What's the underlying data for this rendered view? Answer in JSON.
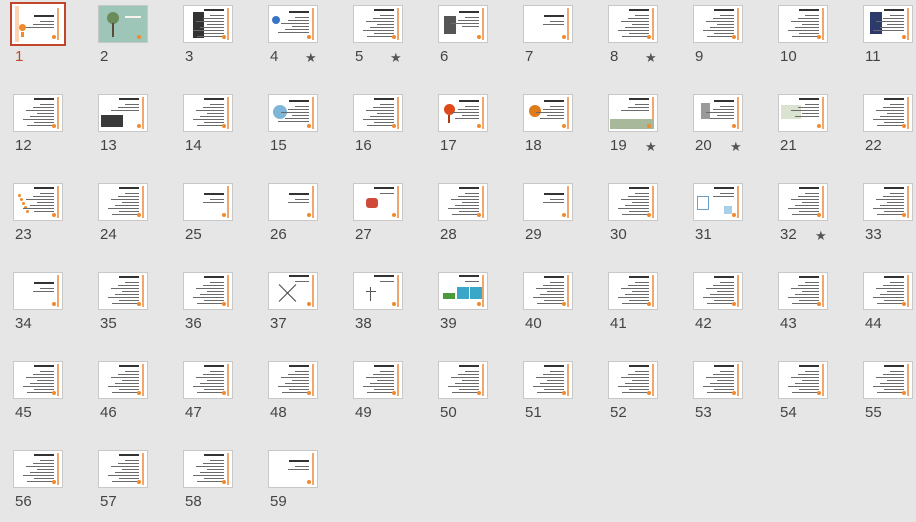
{
  "view": "Slide Sorter",
  "selected_slide": 1,
  "slides": [
    {
      "n": "1",
      "star": false,
      "pic": "title"
    },
    {
      "n": "2",
      "star": false,
      "pic": "tree"
    },
    {
      "n": "3",
      "star": false,
      "pic": "portrait"
    },
    {
      "n": "4",
      "star": true,
      "pic": "globe"
    },
    {
      "n": "5",
      "star": true,
      "pic": "text"
    },
    {
      "n": "6",
      "star": false,
      "pic": "portrait2"
    },
    {
      "n": "7",
      "star": false,
      "pic": "sparse"
    },
    {
      "n": "8",
      "star": true,
      "pic": "text"
    },
    {
      "n": "9",
      "star": false,
      "pic": "text"
    },
    {
      "n": "10",
      "star": false,
      "pic": "text"
    },
    {
      "n": "11",
      "star": false,
      "pic": "people"
    },
    {
      "n": "12",
      "star": false,
      "pic": "text"
    },
    {
      "n": "13",
      "star": false,
      "pic": "dark"
    },
    {
      "n": "14",
      "star": false,
      "pic": "text"
    },
    {
      "n": "15",
      "star": false,
      "pic": "bluefig"
    },
    {
      "n": "16",
      "star": false,
      "pic": "text"
    },
    {
      "n": "17",
      "star": false,
      "pic": "redsign"
    },
    {
      "n": "18",
      "star": false,
      "pic": "face"
    },
    {
      "n": "19",
      "star": true,
      "pic": "crowd"
    },
    {
      "n": "20",
      "star": true,
      "pic": "robot"
    },
    {
      "n": "21",
      "star": false,
      "pic": "map"
    },
    {
      "n": "22",
      "star": false,
      "pic": "text"
    },
    {
      "n": "23",
      "star": false,
      "pic": "dots"
    },
    {
      "n": "24",
      "star": false,
      "pic": "text"
    },
    {
      "n": "25",
      "star": false,
      "pic": "sparse"
    },
    {
      "n": "26",
      "star": false,
      "pic": "sparse"
    },
    {
      "n": "27",
      "star": false,
      "pic": "redicon"
    },
    {
      "n": "28",
      "star": false,
      "pic": "text"
    },
    {
      "n": "29",
      "star": false,
      "pic": "sparse"
    },
    {
      "n": "30",
      "star": false,
      "pic": "text"
    },
    {
      "n": "31",
      "star": false,
      "pic": "diagram"
    },
    {
      "n": "32",
      "star": true,
      "pic": "text"
    },
    {
      "n": "33",
      "star": false,
      "pic": "text"
    },
    {
      "n": "34",
      "star": false,
      "pic": "sparse"
    },
    {
      "n": "35",
      "star": false,
      "pic": "text"
    },
    {
      "n": "36",
      "star": false,
      "pic": "text"
    },
    {
      "n": "37",
      "star": false,
      "pic": "cross"
    },
    {
      "n": "38",
      "star": false,
      "pic": "figure"
    },
    {
      "n": "39",
      "star": false,
      "pic": "boxes"
    },
    {
      "n": "40",
      "star": false,
      "pic": "text"
    },
    {
      "n": "41",
      "star": false,
      "pic": "text"
    },
    {
      "n": "42",
      "star": false,
      "pic": "text"
    },
    {
      "n": "43",
      "star": false,
      "pic": "text"
    },
    {
      "n": "44",
      "star": false,
      "pic": "text"
    },
    {
      "n": "45",
      "star": false,
      "pic": "text"
    },
    {
      "n": "46",
      "star": false,
      "pic": "text"
    },
    {
      "n": "47",
      "star": false,
      "pic": "text"
    },
    {
      "n": "48",
      "star": false,
      "pic": "text"
    },
    {
      "n": "49",
      "star": false,
      "pic": "text"
    },
    {
      "n": "50",
      "star": false,
      "pic": "text"
    },
    {
      "n": "51",
      "star": false,
      "pic": "text"
    },
    {
      "n": "52",
      "star": false,
      "pic": "text"
    },
    {
      "n": "53",
      "star": false,
      "pic": "text"
    },
    {
      "n": "54",
      "star": false,
      "pic": "text"
    },
    {
      "n": "55",
      "star": false,
      "pic": "text"
    },
    {
      "n": "56",
      "star": false,
      "pic": "text"
    },
    {
      "n": "57",
      "star": false,
      "pic": "text"
    },
    {
      "n": "58",
      "star": false,
      "pic": "text"
    },
    {
      "n": "59",
      "star": false,
      "pic": "sparse"
    }
  ],
  "star_glyph": "★",
  "colors": {
    "background": "#e6e6e6",
    "selection": "#c0452a",
    "accent": "#f08a2c"
  }
}
